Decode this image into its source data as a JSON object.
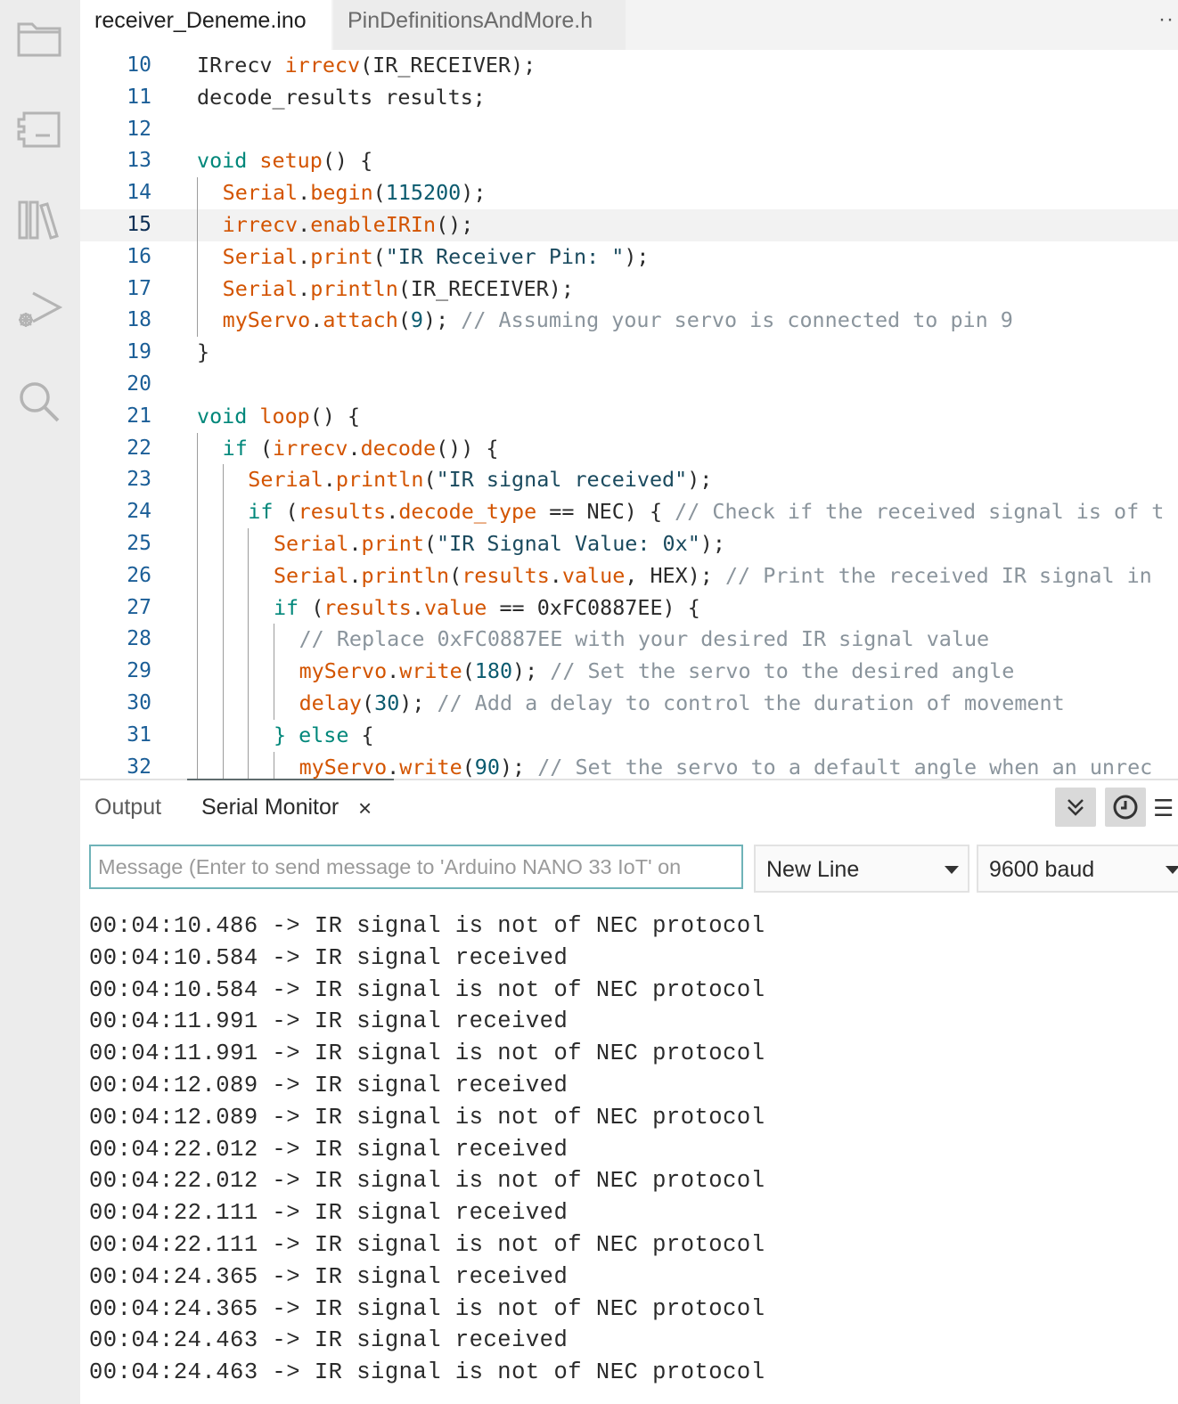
{
  "activity_bar": {
    "icons": [
      "folder-icon",
      "board-icon",
      "library-icon",
      "debug-icon",
      "search-icon"
    ]
  },
  "tabs": [
    {
      "label": "receiver_Deneme.ino",
      "active": true
    },
    {
      "label": "PinDefinitionsAndMore.h",
      "active": false
    }
  ],
  "tabs_more": "··",
  "editor": {
    "current_line": 15,
    "lines": [
      {
        "n": "10",
        "tokens": [
          [
            "id",
            "IRrecv "
          ],
          [
            "fn",
            "irrecv"
          ],
          [
            "id",
            "(IR_RECEIVER);"
          ]
        ]
      },
      {
        "n": "11",
        "tokens": [
          [
            "id",
            "decode_results results;"
          ]
        ]
      },
      {
        "n": "12",
        "tokens": []
      },
      {
        "n": "13",
        "tokens": [
          [
            "kw",
            "void "
          ],
          [
            "fn",
            "setup"
          ],
          [
            "id",
            "() {"
          ]
        ]
      },
      {
        "n": "14",
        "tokens": [
          [
            "obj",
            "Serial"
          ],
          [
            "id",
            "."
          ],
          [
            "fn",
            "begin"
          ],
          [
            "id",
            "("
          ],
          [
            "num",
            "115200"
          ],
          [
            "id",
            ");"
          ]
        ]
      },
      {
        "n": "15",
        "tokens": [
          [
            "fn",
            "irrecv"
          ],
          [
            "id",
            "."
          ],
          [
            "fn",
            "enableIRIn"
          ],
          [
            "id",
            "();"
          ]
        ]
      },
      {
        "n": "16",
        "tokens": [
          [
            "obj",
            "Serial"
          ],
          [
            "id",
            "."
          ],
          [
            "fn",
            "print"
          ],
          [
            "id",
            "("
          ],
          [
            "str",
            "\"IR Receiver Pin: \""
          ],
          [
            "id",
            ");"
          ]
        ]
      },
      {
        "n": "17",
        "tokens": [
          [
            "obj",
            "Serial"
          ],
          [
            "id",
            "."
          ],
          [
            "fn",
            "println"
          ],
          [
            "id",
            "(IR_RECEIVER);"
          ]
        ]
      },
      {
        "n": "18",
        "tokens": [
          [
            "fn",
            "myServo"
          ],
          [
            "id",
            "."
          ],
          [
            "fn",
            "attach"
          ],
          [
            "id",
            "("
          ],
          [
            "num",
            "9"
          ],
          [
            "id",
            "); "
          ],
          [
            "cmt",
            "// Assuming your servo is connected to pin 9"
          ]
        ]
      },
      {
        "n": "19",
        "tokens": [
          [
            "id",
            "}"
          ]
        ]
      },
      {
        "n": "20",
        "tokens": []
      },
      {
        "n": "21",
        "tokens": [
          [
            "kw",
            "void "
          ],
          [
            "fn",
            "loop"
          ],
          [
            "id",
            "() {"
          ]
        ]
      },
      {
        "n": "22",
        "tokens": [
          [
            "kw",
            "if "
          ],
          [
            "id",
            "("
          ],
          [
            "fn",
            "irrecv"
          ],
          [
            "id",
            "."
          ],
          [
            "fn",
            "decode"
          ],
          [
            "id",
            "()) {"
          ]
        ]
      },
      {
        "n": "23",
        "tokens": [
          [
            "obj",
            "Serial"
          ],
          [
            "id",
            "."
          ],
          [
            "fn",
            "println"
          ],
          [
            "id",
            "("
          ],
          [
            "str",
            "\"IR signal received\""
          ],
          [
            "id",
            ");"
          ]
        ]
      },
      {
        "n": "24",
        "tokens": [
          [
            "kw",
            "if "
          ],
          [
            "id",
            "("
          ],
          [
            "fn",
            "results"
          ],
          [
            "id",
            "."
          ],
          [
            "fn",
            "decode_type"
          ],
          [
            "id",
            " == NEC) { "
          ],
          [
            "cmt",
            "// Check if the received signal is of t"
          ]
        ]
      },
      {
        "n": "25",
        "tokens": [
          [
            "obj",
            "Serial"
          ],
          [
            "id",
            "."
          ],
          [
            "fn",
            "print"
          ],
          [
            "id",
            "("
          ],
          [
            "str",
            "\"IR Signal Value: 0x\""
          ],
          [
            "id",
            ");"
          ]
        ]
      },
      {
        "n": "26",
        "tokens": [
          [
            "obj",
            "Serial"
          ],
          [
            "id",
            "."
          ],
          [
            "fn",
            "println"
          ],
          [
            "id",
            "("
          ],
          [
            "fn",
            "results"
          ],
          [
            "id",
            "."
          ],
          [
            "fn",
            "value"
          ],
          [
            "id",
            ", HEX); "
          ],
          [
            "cmt",
            "// Print the received IR signal in"
          ]
        ]
      },
      {
        "n": "27",
        "tokens": [
          [
            "kw",
            "if "
          ],
          [
            "id",
            "("
          ],
          [
            "fn",
            "results"
          ],
          [
            "id",
            "."
          ],
          [
            "fn",
            "value"
          ],
          [
            "id",
            " == 0xFC0887EE) {"
          ]
        ]
      },
      {
        "n": "28",
        "tokens": [
          [
            "cmt",
            "// Replace 0xFC0887EE with your desired IR signal value"
          ]
        ]
      },
      {
        "n": "29",
        "tokens": [
          [
            "fn",
            "myServo"
          ],
          [
            "id",
            "."
          ],
          [
            "fn",
            "write"
          ],
          [
            "id",
            "("
          ],
          [
            "num",
            "180"
          ],
          [
            "id",
            "); "
          ],
          [
            "cmt",
            "// Set the servo to the desired angle"
          ]
        ]
      },
      {
        "n": "30",
        "tokens": [
          [
            "fn",
            "delay"
          ],
          [
            "id",
            "("
          ],
          [
            "num",
            "30"
          ],
          [
            "id",
            "); "
          ],
          [
            "cmt",
            "// Add a delay to control the duration of movement"
          ]
        ]
      },
      {
        "n": "31",
        "tokens": [
          [
            "kw",
            "} else "
          ],
          [
            "id",
            "{"
          ]
        ]
      },
      {
        "n": "32",
        "tokens": [
          [
            "fn",
            "myServo"
          ],
          [
            "id",
            "."
          ],
          [
            "fn",
            "write"
          ],
          [
            "id",
            "("
          ],
          [
            "num",
            "90"
          ],
          [
            "id",
            "); "
          ],
          [
            "cmt",
            "// Set the servo to a default angle when an unrec"
          ]
        ]
      }
    ]
  },
  "panel": {
    "tab_output": "Output",
    "tab_serial": "Serial Monitor",
    "close_glyph": "×",
    "menu_glyph": "☰"
  },
  "serial": {
    "placeholder": "Message (Enter to send message to 'Arduino NANO 33 IoT' on",
    "line_ending": "New Line",
    "baud": "9600 baud",
    "lines": [
      "00:04:10.486 -> IR signal is not of NEC protocol",
      "00:04:10.584 -> IR signal received",
      "00:04:10.584 -> IR signal is not of NEC protocol",
      "00:04:11.991 -> IR signal received",
      "00:04:11.991 -> IR signal is not of NEC protocol",
      "00:04:12.089 -> IR signal received",
      "00:04:12.089 -> IR signal is not of NEC protocol",
      "00:04:22.012 -> IR signal received",
      "00:04:22.012 -> IR signal is not of NEC protocol",
      "00:04:22.111 -> IR signal received",
      "00:04:22.111 -> IR signal is not of NEC protocol",
      "00:04:24.365 -> IR signal received",
      "00:04:24.365 -> IR signal is not of NEC protocol",
      "00:04:24.463 -> IR signal received",
      "00:04:24.463 -> IR signal is not of NEC protocol"
    ]
  }
}
